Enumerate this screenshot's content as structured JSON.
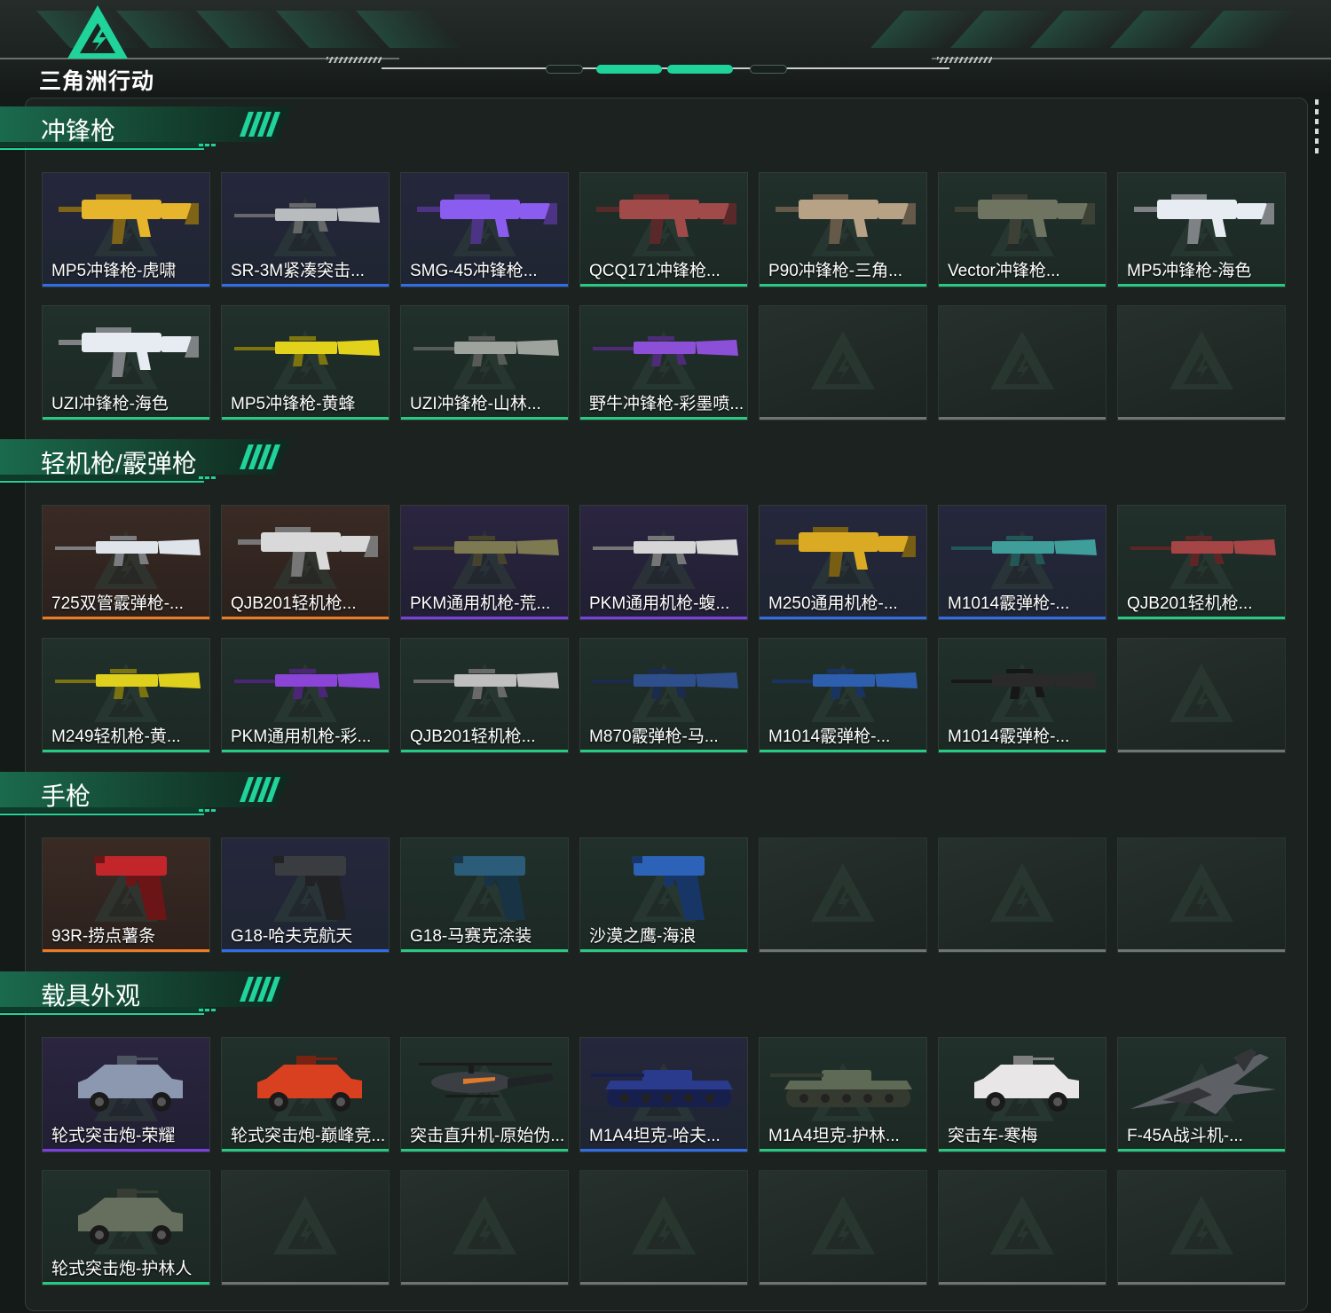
{
  "game": {
    "logo_text": "三角洲行动",
    "logo_color": "#1fd39a"
  },
  "colors": {
    "background": "#141a17",
    "accent": "#1fd39a",
    "quality_blue": "#2f6ee8",
    "quality_green": "#27c983",
    "quality_purple": "#7a3fe0",
    "quality_orange": "#f07a1f",
    "empty_bar": "#6e7572"
  },
  "sections": [
    {
      "title": "冲锋枪",
      "items": [
        {
          "name": "MP5冲锋枪-虎啸",
          "quality": "blue",
          "kind": "gun",
          "tint": "#e7b52b"
        },
        {
          "name": "SR-3M紧凑突击...",
          "quality": "blue",
          "kind": "rifle",
          "tint": "#b9bcbf"
        },
        {
          "name": "SMG-45冲锋枪...",
          "quality": "blue",
          "kind": "gun",
          "tint": "#8b5cf0"
        },
        {
          "name": "QCQ171冲锋枪...",
          "quality": "green",
          "kind": "gun",
          "tint": "#a14a4a"
        },
        {
          "name": "P90冲锋枪-三角...",
          "quality": "green",
          "kind": "gun",
          "tint": "#b7a285"
        },
        {
          "name": "Vector冲锋枪...",
          "quality": "green",
          "kind": "gun",
          "tint": "#6f7460"
        },
        {
          "name": "MP5冲锋枪-海色",
          "quality": "green",
          "kind": "gun",
          "tint": "#e6ecf2"
        },
        {
          "name": "UZI冲锋枪-海色",
          "quality": "green",
          "kind": "gun",
          "tint": "#e6ecf2"
        },
        {
          "name": "MP5冲锋枪-黄蜂",
          "quality": "green",
          "kind": "rifle",
          "tint": "#e3d21c"
        },
        {
          "name": "UZI冲锋枪-山林...",
          "quality": "green",
          "kind": "rifle",
          "tint": "#9ea39d"
        },
        {
          "name": "野牛冲锋枪-彩墨喷...",
          "quality": "green",
          "kind": "rifle",
          "tint": "#8c4fd8"
        },
        {
          "empty": true
        },
        {
          "empty": true
        },
        {
          "empty": true
        }
      ]
    },
    {
      "title": "轻机枪/霰弹枪",
      "items": [
        {
          "name": "725双管霰弹枪-...",
          "quality": "orange",
          "kind": "rifle",
          "tint": "#dfe4ea"
        },
        {
          "name": "QJB201轻机枪...",
          "quality": "orange",
          "kind": "gun",
          "tint": "#d9d9d9"
        },
        {
          "name": "PKM通用机枪-荒...",
          "quality": "purple",
          "kind": "rifle",
          "tint": "#7d7a52"
        },
        {
          "name": "PKM通用机枪-蝮...",
          "quality": "purple",
          "kind": "rifle",
          "tint": "#d6d6d6"
        },
        {
          "name": "M250通用机枪-...",
          "quality": "blue",
          "kind": "gun",
          "tint": "#d9aa22"
        },
        {
          "name": "M1014霰弹枪-...",
          "quality": "blue",
          "kind": "rifle",
          "tint": "#3f9e9a"
        },
        {
          "name": "QJB201轻机枪...",
          "quality": "green",
          "kind": "rifle",
          "tint": "#a64545"
        },
        {
          "name": "M249轻机枪-黄...",
          "quality": "green",
          "kind": "rifle",
          "tint": "#e0d01e"
        },
        {
          "name": "PKM通用机枪-彩...",
          "quality": "green",
          "kind": "rifle",
          "tint": "#8a45d6"
        },
        {
          "name": "QJB201轻机枪...",
          "quality": "green",
          "kind": "rifle",
          "tint": "#bfbfbf"
        },
        {
          "name": "M870霰弹枪-马...",
          "quality": "green",
          "kind": "rifle",
          "tint": "#2f4f8c"
        },
        {
          "name": "M1014霰弹枪-...",
          "quality": "green",
          "kind": "rifle",
          "tint": "#2d5fae"
        },
        {
          "name": "M1014霰弹枪-...",
          "quality": "green",
          "kind": "rifle",
          "tint": "#2a2a2a"
        },
        {
          "empty": true
        }
      ]
    },
    {
      "title": "手枪",
      "items": [
        {
          "name": "93R-捞点薯条",
          "quality": "orange",
          "kind": "pistol",
          "tint": "#c3262a"
        },
        {
          "name": "G18-哈夫克航天",
          "quality": "blue",
          "kind": "pistol",
          "tint": "#3a3d40"
        },
        {
          "name": "G18-马赛克涂装",
          "quality": "green",
          "kind": "pistol",
          "tint": "#2b5c7a"
        },
        {
          "name": "沙漠之鹰-海浪",
          "quality": "green",
          "kind": "pistol",
          "tint": "#2c63b8"
        },
        {
          "empty": true
        },
        {
          "empty": true
        },
        {
          "empty": true
        }
      ]
    },
    {
      "title": "载具外观",
      "items": [
        {
          "name": "轮式突击炮-荣耀",
          "quality": "purple",
          "kind": "vehicle",
          "tint": "#8c98b0"
        },
        {
          "name": "轮式突击炮-巅峰竞...",
          "quality": "green",
          "kind": "vehicle",
          "tint": "#d9401f"
        },
        {
          "name": "突击直升机-原始伪...",
          "quality": "green",
          "kind": "heli",
          "tint": "#3b3f44"
        },
        {
          "name": "M1A4坦克-哈夫...",
          "quality": "blue",
          "kind": "tank",
          "tint": "#2a3a8c"
        },
        {
          "name": "M1A4坦克-护林...",
          "quality": "green",
          "kind": "tank",
          "tint": "#5f6a56"
        },
        {
          "name": "突击车-寒梅",
          "quality": "green",
          "kind": "vehicle",
          "tint": "#e8e6e6"
        },
        {
          "name": "F-45A战斗机-...",
          "quality": "green",
          "kind": "jet",
          "tint": "#5d6166"
        },
        {
          "name": "轮式突击炮-护林人",
          "quality": "green",
          "kind": "vehicle",
          "tint": "#666f5e"
        },
        {
          "empty": true
        },
        {
          "empty": true
        },
        {
          "empty": true
        },
        {
          "empty": true
        },
        {
          "empty": true
        },
        {
          "empty": true
        }
      ]
    }
  ]
}
